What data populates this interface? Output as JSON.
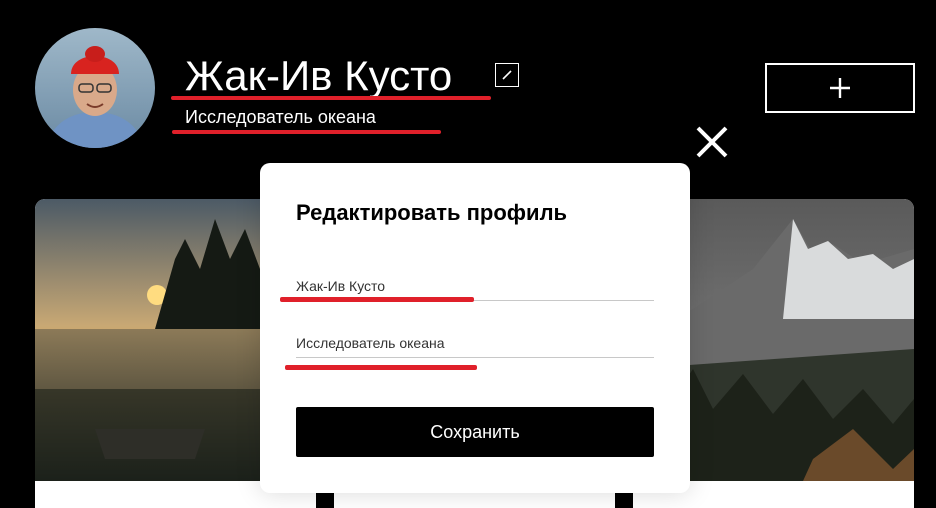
{
  "profile": {
    "name": "Жак-Ив Кусто",
    "about": "Исследователь океана"
  },
  "icons": {
    "edit": "pencil-icon",
    "add": "plus-icon",
    "close": "close-icon"
  },
  "popup": {
    "title": "Редактировать профиль",
    "name_value": "Жак-Ив Кусто",
    "about_value": "Исследователь океана",
    "save_label": "Сохранить"
  },
  "colors": {
    "background": "#000000",
    "accent_underline": "#e0202a",
    "popup_bg": "#ffffff"
  }
}
